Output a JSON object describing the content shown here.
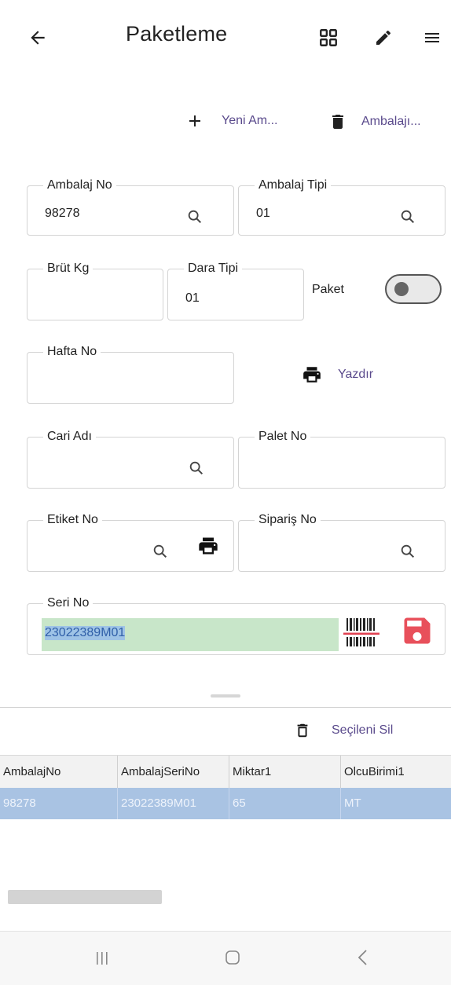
{
  "appbar": {
    "title": "Paketleme",
    "back_icon": "arrow-left-icon",
    "icons": [
      "grid-icon",
      "pencil-icon",
      "menu-icon"
    ]
  },
  "actions": {
    "new_label": "Yeni Am...",
    "delete_label": "Ambalajı..."
  },
  "form": {
    "ambalaj_no": {
      "label": "Ambalaj No",
      "value": "98278"
    },
    "ambalaj_tipi": {
      "label": "Ambalaj Tipi",
      "value": "01"
    },
    "brut_kg": {
      "label": "Brüt Kg",
      "value": ""
    },
    "dara_tipi": {
      "label": "Dara Tipi",
      "value": "01"
    },
    "paket": {
      "label": "Paket",
      "checked": false
    },
    "hafta_no": {
      "label": "Hafta No",
      "value": ""
    },
    "print_label": "Yazdır",
    "cari_adi": {
      "label": "Cari Adı",
      "value": ""
    },
    "palet_no": {
      "label": "Palet No",
      "value": ""
    },
    "etiket_no": {
      "label": "Etiket No",
      "value": ""
    },
    "siparis_no": {
      "label": "Sipariş No",
      "value": ""
    },
    "seri_no": {
      "label": "Seri No",
      "value": "23022389M01"
    }
  },
  "grid": {
    "delete_selected_label": "Seçileni Sil",
    "columns": [
      "AmbalajNo",
      "AmbalajSeriNo",
      "Miktar1",
      "OlcuBirimi1"
    ],
    "rows": [
      [
        "98278",
        "23022389M01",
        "65",
        "MT"
      ]
    ]
  },
  "colors": {
    "accent": "#5a4a8c",
    "selected_row": "#a9c3e3",
    "serial_highlight": "#c8e6c9",
    "save_icon": "#e8505b"
  }
}
